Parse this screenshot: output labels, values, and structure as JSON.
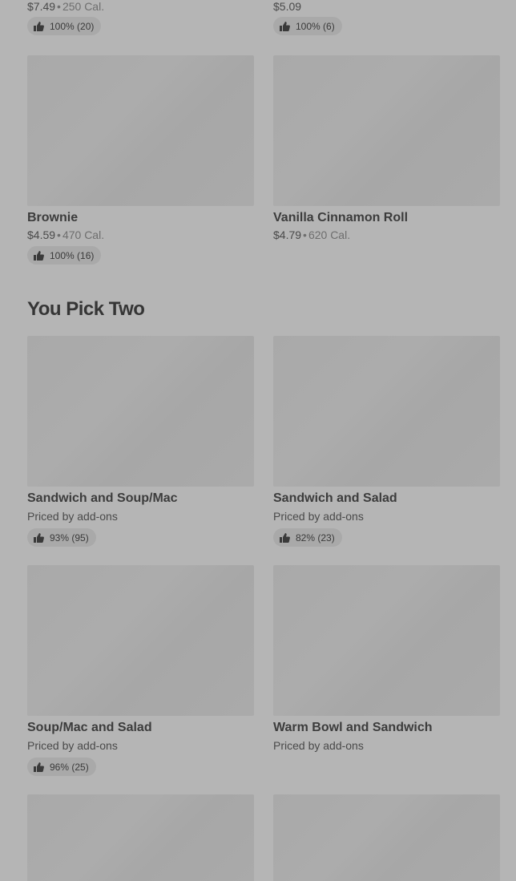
{
  "top_row": {
    "left": {
      "price": "$7.49",
      "calories": "250 Cal.",
      "rating": "100% (20)"
    },
    "right": {
      "price": "$5.09",
      "rating": "100% (6)"
    }
  },
  "desserts": [
    {
      "name": "Brownie",
      "price": "$4.59",
      "calories": "470 Cal.",
      "rating": "100% (16)"
    },
    {
      "name": "Vanilla Cinnamon Roll",
      "price": "$4.79",
      "calories": "620 Cal."
    }
  ],
  "section": {
    "title": "You Pick Two"
  },
  "pick_two": [
    {
      "name": "Sandwich and Soup/Mac",
      "subtitle": "Priced by add-ons",
      "rating": "93% (95)"
    },
    {
      "name": "Sandwich and Salad",
      "subtitle": "Priced by add-ons",
      "rating": "82% (23)"
    },
    {
      "name": "Soup/Mac and Salad",
      "subtitle": "Priced by add-ons",
      "rating": "96% (25)"
    },
    {
      "name": "Warm Bowl and Sandwich",
      "subtitle": "Priced by add-ons"
    }
  ],
  "icons": {
    "rating_icon": "thumbs-up-icon"
  },
  "colors": {
    "overlay": "#b5b5b5",
    "placeholder": "#aaaaaa",
    "pill": "#a9a9a9",
    "text": "#3c3c3c"
  }
}
